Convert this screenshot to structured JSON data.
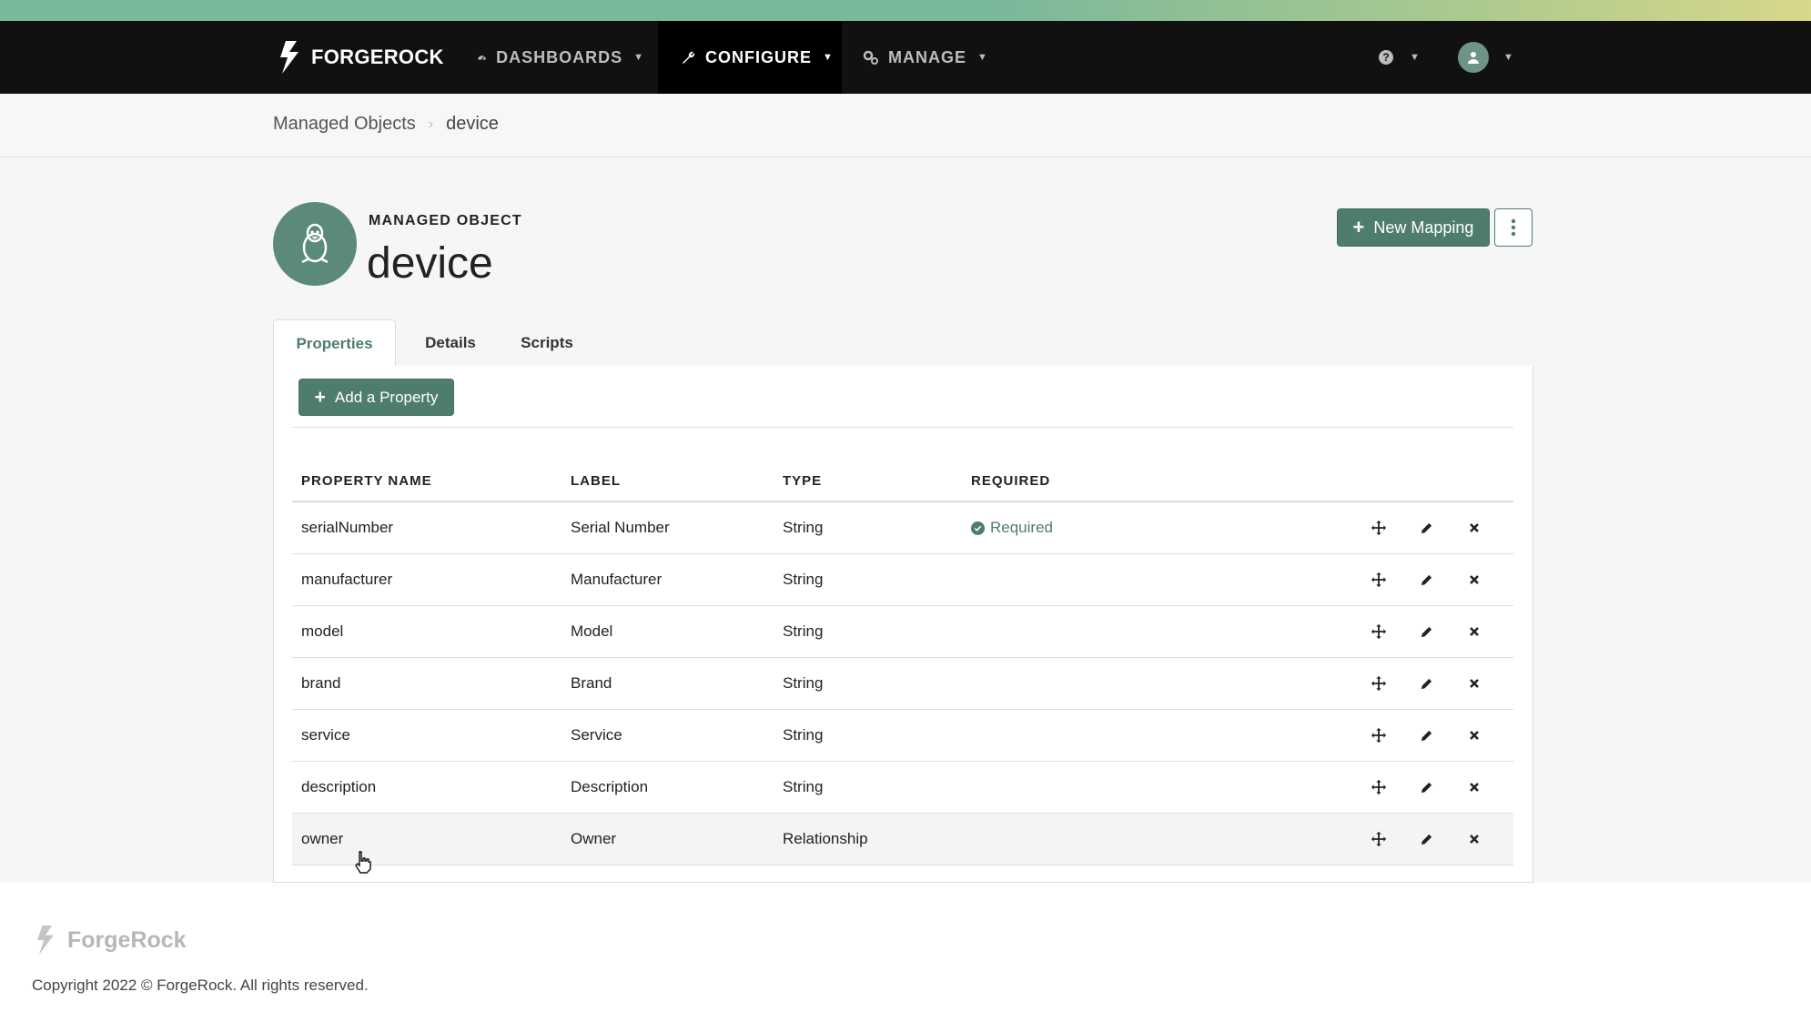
{
  "brand": {
    "name": "FORGEROCK"
  },
  "nav": {
    "items": [
      {
        "label": "DASHBOARDS",
        "icon": "dashboard-icon",
        "active": false
      },
      {
        "label": "CONFIGURE",
        "icon": "wrench-icon",
        "active": true
      },
      {
        "label": "MANAGE",
        "icon": "cogs-icon",
        "active": false
      }
    ],
    "help_icon": "question-circle-icon",
    "user_icon": "user-avatar-icon"
  },
  "breadcrumb": {
    "parent": "Managed Objects",
    "current": "device"
  },
  "header": {
    "kicker": "MANAGED OBJECT",
    "title": "device",
    "object_icon": "linux-penguin-icon",
    "new_mapping_label": "New Mapping"
  },
  "tabs": [
    {
      "label": "Properties",
      "active": true
    },
    {
      "label": "Details",
      "active": false
    },
    {
      "label": "Scripts",
      "active": false
    }
  ],
  "properties": {
    "add_label": "Add a Property",
    "columns": [
      "PROPERTY NAME",
      "LABEL",
      "TYPE",
      "REQUIRED"
    ],
    "rows": [
      {
        "name": "serialNumber",
        "label": "Serial Number",
        "type": "String",
        "required": "Required"
      },
      {
        "name": "manufacturer",
        "label": "Manufacturer",
        "type": "String",
        "required": ""
      },
      {
        "name": "model",
        "label": "Model",
        "type": "String",
        "required": ""
      },
      {
        "name": "brand",
        "label": "Brand",
        "type": "String",
        "required": ""
      },
      {
        "name": "service",
        "label": "Service",
        "type": "String",
        "required": ""
      },
      {
        "name": "description",
        "label": "Description",
        "type": "String",
        "required": ""
      },
      {
        "name": "owner",
        "label": "Owner",
        "type": "Relationship",
        "required": ""
      }
    ]
  },
  "footer": {
    "logo_text": "ForgeRock",
    "copyright": "Copyright 2022 © ForgeRock.  All rights reserved."
  },
  "colors": {
    "accent": "#4f7d6d",
    "navbar": "#111111",
    "gradient_start": "#7ab89a",
    "gradient_end": "#d8d78a"
  }
}
